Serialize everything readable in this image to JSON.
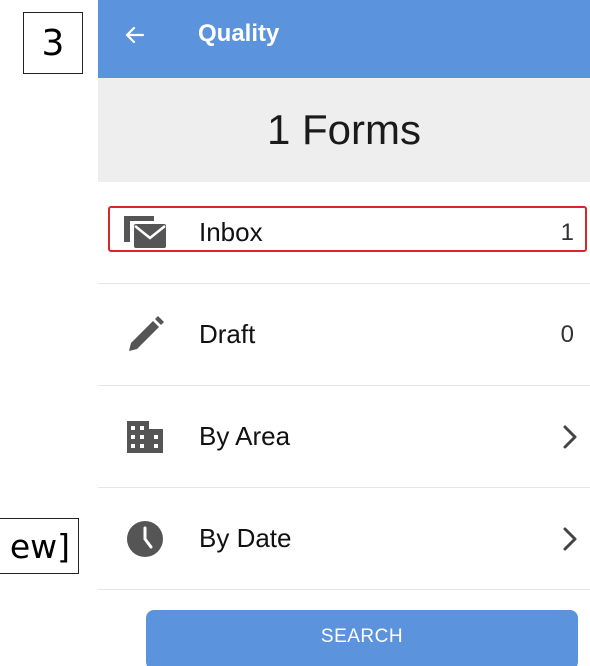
{
  "annotations": {
    "step_number": "3",
    "side_note_text": "ew]"
  },
  "appbar": {
    "back_icon": "arrow-left-icon",
    "title": "Quality"
  },
  "header": {
    "forms_count_title": "1 Forms"
  },
  "list": {
    "items": [
      {
        "label": "Inbox",
        "count": "1",
        "icon": "inbox-icon"
      },
      {
        "label": "Draft",
        "count": "0",
        "icon": "pencil-icon"
      },
      {
        "label": "By Area",
        "icon": "building-icon",
        "trailing": "chevron-right-icon"
      },
      {
        "label": "By Date",
        "icon": "clock-icon",
        "trailing": "chevron-right-icon"
      }
    ]
  },
  "search": {
    "label": "SEARCH"
  },
  "colors": {
    "primary": "#5b94dc",
    "header_bg": "#eeeeee",
    "highlight": "#d9262a",
    "icon": "#555555"
  }
}
